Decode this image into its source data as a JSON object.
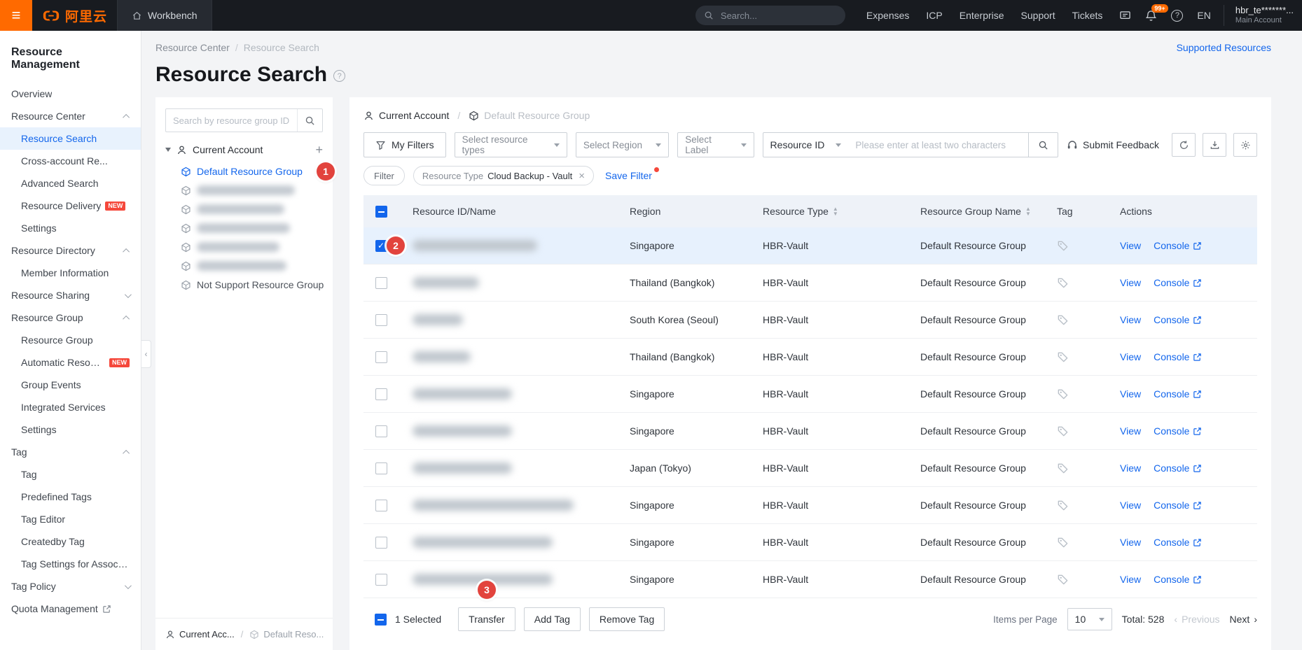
{
  "appearance": {
    "accent_orange": "#ff6a00",
    "link_blue": "#1366ec",
    "annotation_red": "#e2433d"
  },
  "topbar": {
    "logo_text": "阿里云",
    "workbench_label": "Workbench",
    "search_placeholder": "Search...",
    "nav_items": [
      "Expenses",
      "ICP",
      "Enterprise",
      "Support",
      "Tickets"
    ],
    "notification_count": "99+",
    "language": "EN",
    "account_name": "hbr_te*******...",
    "account_type": "Main Account"
  },
  "sidebar": {
    "title": "Resource Management",
    "items": [
      {
        "label": "Overview"
      },
      {
        "label": "Resource Center",
        "chevron": "up"
      },
      {
        "label": "Resource Search",
        "indent": true,
        "selected": true
      },
      {
        "label": "Cross-account Re...",
        "indent": true
      },
      {
        "label": "Advanced Search",
        "indent": true
      },
      {
        "label": "Resource Delivery",
        "indent": true,
        "badge": "NEW"
      },
      {
        "label": "Settings",
        "indent": true
      },
      {
        "label": "Resource Directory",
        "chevron": "up"
      },
      {
        "label": "Member Information",
        "indent": true
      },
      {
        "label": "Resource Sharing",
        "chevron": "down"
      },
      {
        "label": "Resource Group",
        "chevron": "up"
      },
      {
        "label": "Resource Group",
        "indent": true
      },
      {
        "label": "Automatic Resource...",
        "indent": true,
        "badge": "NEW"
      },
      {
        "label": "Group Events",
        "indent": true
      },
      {
        "label": "Integrated Services",
        "indent": true
      },
      {
        "label": "Settings",
        "indent": true
      },
      {
        "label": "Tag",
        "chevron": "up"
      },
      {
        "label": "Tag",
        "indent": true
      },
      {
        "label": "Predefined Tags",
        "indent": true
      },
      {
        "label": "Tag Editor",
        "indent": true
      },
      {
        "label": "Createdby Tag",
        "indent": true
      },
      {
        "label": "Tag Settings for Associated",
        "indent": true
      },
      {
        "label": "Tag Policy",
        "chevron": "down"
      },
      {
        "label": "Quota Management",
        "external": true
      }
    ]
  },
  "breadcrumb": {
    "parent": "Resource Center",
    "current": "Resource Search"
  },
  "page": {
    "title": "Resource Search",
    "supported_resources_link": "Supported Resources"
  },
  "tree": {
    "search_placeholder": "Search by resource group ID o",
    "root_label": "Current Account",
    "selected_group": "Default Resource Group",
    "redacted": [
      {},
      {},
      {},
      {},
      {}
    ],
    "not_support_label": "Not Support Resource Group",
    "footer_account": "Current Acc...",
    "footer_group": "Default Reso..."
  },
  "content": {
    "path_account": "Current Account",
    "path_group": "Default Resource Group",
    "toolbar": {
      "my_filters": "My Filters",
      "select_resource_types": "Select resource types",
      "select_region": "Select Region",
      "select_label": "Select Label",
      "resource_id": "Resource ID",
      "search_placeholder": "Please enter at least two characters",
      "submit_feedback": "Submit Feedback"
    },
    "filters": {
      "filter_label": "Filter",
      "applied_key": "Resource Type",
      "applied_value": "Cloud Backup - Vault",
      "save_filter": "Save Filter"
    }
  },
  "table": {
    "columns": [
      "Resource ID/Name",
      "Region",
      "Resource Type",
      "Resource Group Name",
      "Tag",
      "Actions"
    ],
    "view_label": "View",
    "console_label": "Console",
    "rows": [
      {
        "region": "Singapore",
        "resource_type": "HBR-Vault",
        "resource_group": "Default Resource Group",
        "selected": true
      },
      {
        "region": "Thailand (Bangkok)",
        "resource_type": "HBR-Vault",
        "resource_group": "Default Resource Group"
      },
      {
        "region": "South Korea (Seoul)",
        "resource_type": "HBR-Vault",
        "resource_group": "Default Resource Group"
      },
      {
        "region": "Thailand (Bangkok)",
        "resource_type": "HBR-Vault",
        "resource_group": "Default Resource Group"
      },
      {
        "region": "Singapore",
        "resource_type": "HBR-Vault",
        "resource_group": "Default Resource Group"
      },
      {
        "region": "Singapore",
        "resource_type": "HBR-Vault",
        "resource_group": "Default Resource Group"
      },
      {
        "region": "Japan (Tokyo)",
        "resource_type": "HBR-Vault",
        "resource_group": "Default Resource Group"
      },
      {
        "region": "Singapore",
        "resource_type": "HBR-Vault",
        "resource_group": "Default Resource Group"
      },
      {
        "region": "Singapore",
        "resource_type": "HBR-Vault",
        "resource_group": "Default Resource Group"
      },
      {
        "region": "Singapore",
        "resource_type": "HBR-Vault",
        "resource_group": "Default Resource Group"
      }
    ]
  },
  "footer": {
    "selected_count": "1 Selected",
    "transfer": "Transfer",
    "add_tag": "Add Tag",
    "remove_tag": "Remove Tag",
    "items_per_page_label": "Items per Page",
    "page_size": "10",
    "total": "Total: 528",
    "previous": "Previous",
    "next": "Next"
  },
  "annotations": {
    "step1": "1",
    "step2": "2",
    "step3": "3"
  }
}
